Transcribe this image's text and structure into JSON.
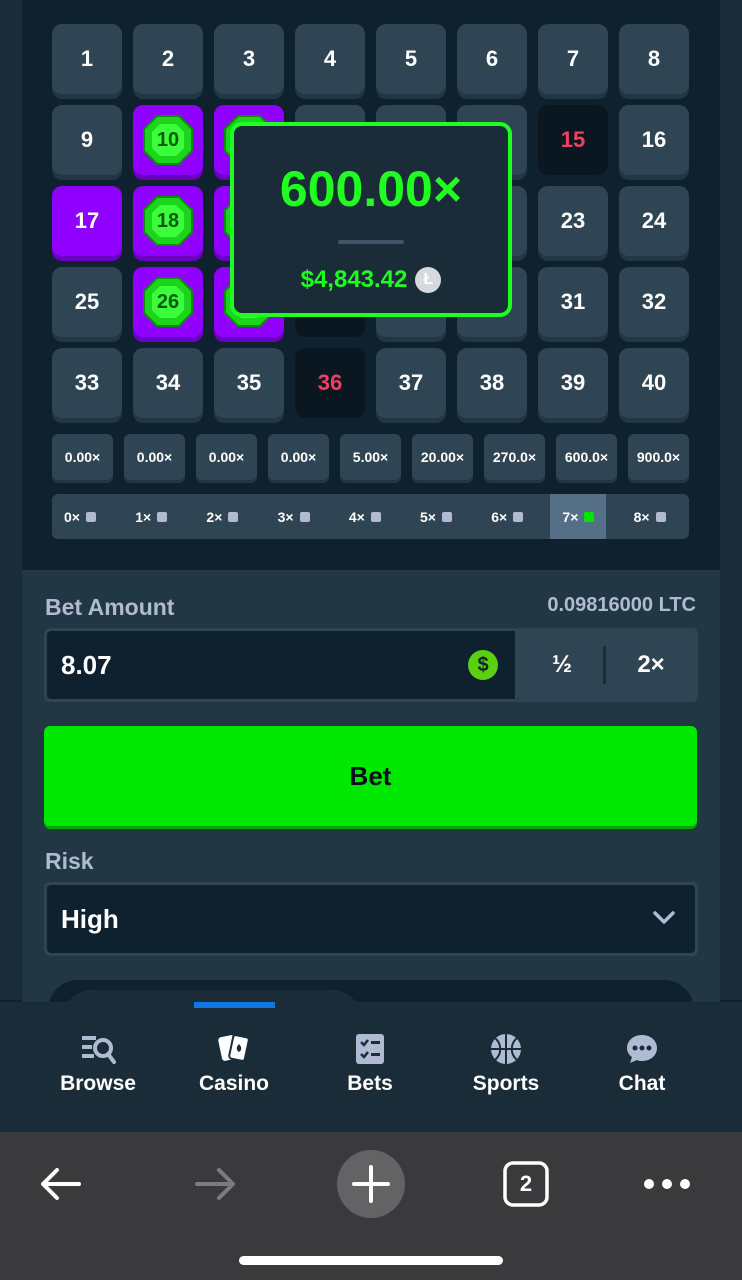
{
  "grid": {
    "tiles": [
      {
        "n": "1",
        "s": "normal"
      },
      {
        "n": "2",
        "s": "normal"
      },
      {
        "n": "3",
        "s": "normal"
      },
      {
        "n": "4",
        "s": "normal"
      },
      {
        "n": "5",
        "s": "normal"
      },
      {
        "n": "6",
        "s": "normal"
      },
      {
        "n": "7",
        "s": "normal"
      },
      {
        "n": "8",
        "s": "normal"
      },
      {
        "n": "9",
        "s": "normal"
      },
      {
        "n": "10",
        "s": "hit"
      },
      {
        "n": "",
        "s": "hit"
      },
      {
        "n": "",
        "s": "normal"
      },
      {
        "n": "",
        "s": "normal"
      },
      {
        "n": "",
        "s": "normal"
      },
      {
        "n": "15",
        "s": "miss"
      },
      {
        "n": "16",
        "s": "normal"
      },
      {
        "n": "17",
        "s": "picked"
      },
      {
        "n": "18",
        "s": "hit"
      },
      {
        "n": "",
        "s": "hit"
      },
      {
        "n": "",
        "s": "normal"
      },
      {
        "n": "",
        "s": "normal"
      },
      {
        "n": "",
        "s": "normal"
      },
      {
        "n": "23",
        "s": "normal"
      },
      {
        "n": "24",
        "s": "normal"
      },
      {
        "n": "25",
        "s": "normal"
      },
      {
        "n": "26",
        "s": "hit"
      },
      {
        "n": "",
        "s": "hit"
      },
      {
        "n": "",
        "s": "miss"
      },
      {
        "n": "",
        "s": "normal"
      },
      {
        "n": "",
        "s": "normal"
      },
      {
        "n": "31",
        "s": "normal"
      },
      {
        "n": "32",
        "s": "normal"
      },
      {
        "n": "33",
        "s": "normal"
      },
      {
        "n": "34",
        "s": "normal"
      },
      {
        "n": "35",
        "s": "normal"
      },
      {
        "n": "36",
        "s": "miss"
      },
      {
        "n": "37",
        "s": "normal"
      },
      {
        "n": "38",
        "s": "normal"
      },
      {
        "n": "39",
        "s": "normal"
      },
      {
        "n": "40",
        "s": "normal"
      }
    ]
  },
  "payouts": [
    "0.00×",
    "0.00×",
    "0.00×",
    "0.00×",
    "5.00×",
    "20.00×",
    "270.0×",
    "600.0×",
    "900.0×"
  ],
  "hits": {
    "labels": [
      "0×",
      "1×",
      "2×",
      "3×",
      "4×",
      "5×",
      "6×",
      "7×",
      "8×"
    ],
    "active_index": 7
  },
  "popup": {
    "multiplier": "600.00×",
    "amount": "$4,843.42",
    "currency_icon": "litecoin-icon"
  },
  "bet": {
    "label": "Bet Amount",
    "balance": "0.09816000 LTC",
    "value": "8.07",
    "half_label": "½",
    "double_label": "2×",
    "button_label": "Bet"
  },
  "risk": {
    "label": "Risk",
    "value": "High"
  },
  "nav": {
    "items": [
      {
        "label": "Browse",
        "icon": "browse-icon"
      },
      {
        "label": "Casino",
        "icon": "casino-cards-icon"
      },
      {
        "label": "Bets",
        "icon": "bets-checklist-icon"
      },
      {
        "label": "Sports",
        "icon": "basketball-icon"
      },
      {
        "label": "Chat",
        "icon": "chat-bubble-icon"
      }
    ],
    "active_index": 1
  },
  "browser": {
    "tab_count": "2"
  },
  "colors": {
    "accent_green": "#00e701",
    "win_green": "#1fff20",
    "purple": "#9000ff",
    "miss_red": "#ed4163",
    "bg": "#0f212e"
  }
}
